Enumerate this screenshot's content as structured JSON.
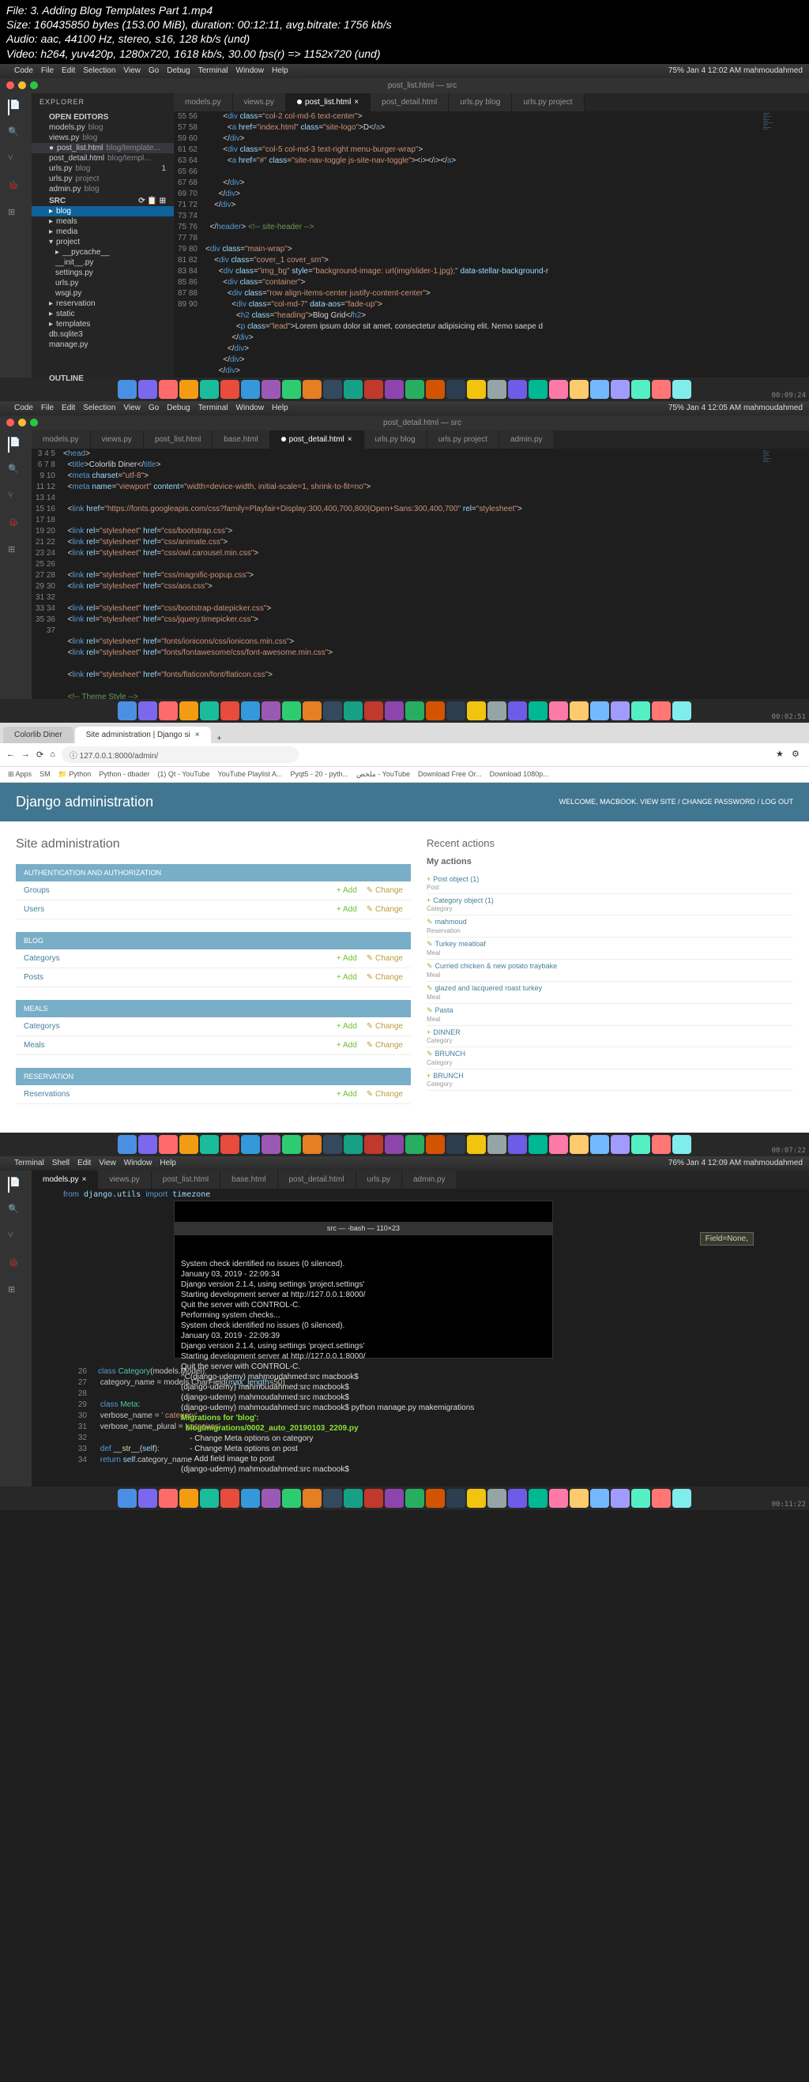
{
  "file_info": {
    "file": "File: 3. Adding Blog Templates Part 1.mp4",
    "size": "Size: 160435850 bytes (153.00 MiB), duration: 00:12:11, avg.bitrate: 1756 kb/s",
    "audio": "Audio: aac, 44100 Hz, stereo, s16, 128 kb/s (und)",
    "video": "Video: h264, yuv420p, 1280x720, 1618 kb/s, 30.00 fps(r) => 1152x720 (und)"
  },
  "menubar1": {
    "app": "Code",
    "items": [
      "File",
      "Edit",
      "Selection",
      "View",
      "Go",
      "Debug",
      "Terminal",
      "Window",
      "Help"
    ],
    "right": "75%  Jan 4 12:02 AM  mahmoudahmed"
  },
  "vscode1": {
    "title": "post_list.html — src",
    "explorer": "EXPLORER",
    "open_editors": "OPEN EDITORS",
    "editors": [
      {
        "name": "models.py",
        "path": "blog"
      },
      {
        "name": "views.py",
        "path": "blog"
      },
      {
        "name": "post_list.html",
        "path": "blog/template..."
      },
      {
        "name": "post_detail.html",
        "path": "blog/templ..."
      },
      {
        "name": "urls.py",
        "path": "blog",
        "badge": "1"
      },
      {
        "name": "urls.py",
        "path": "project"
      },
      {
        "name": "admin.py",
        "path": "blog"
      }
    ],
    "src": "SRC",
    "tree": [
      {
        "name": "blog",
        "type": "folder",
        "selected": true
      },
      {
        "name": "meals",
        "type": "folder"
      },
      {
        "name": "media",
        "type": "folder"
      },
      {
        "name": "project",
        "type": "folder",
        "open": true
      },
      {
        "name": "__pycache__",
        "type": "folder",
        "indent": 1
      },
      {
        "name": "__init__.py",
        "type": "file",
        "indent": 1
      },
      {
        "name": "settings.py",
        "type": "file",
        "indent": 1
      },
      {
        "name": "urls.py",
        "type": "file",
        "indent": 1
      },
      {
        "name": "wsgi.py",
        "type": "file",
        "indent": 1
      },
      {
        "name": "reservation",
        "type": "folder"
      },
      {
        "name": "static",
        "type": "folder"
      },
      {
        "name": "templates",
        "type": "folder"
      },
      {
        "name": "db.sqlite3",
        "type": "file"
      },
      {
        "name": "manage.py",
        "type": "file"
      }
    ],
    "outline": "OUTLINE",
    "tabs": [
      "models.py",
      "views.py",
      "post_list.html",
      "post_detail.html",
      "urls.py blog",
      "urls.py project"
    ],
    "active_tab": 2,
    "line_start": 55,
    "ts": "00:09:24"
  },
  "menubar2": {
    "app": "Code",
    "right": "75%  Jan 4 12:05 AM  mahmoudahmed"
  },
  "vscode2": {
    "title": "post_detail.html — src",
    "tabs": [
      "models.py",
      "views.py",
      "post_list.html",
      "base.html",
      "post_detail.html",
      "urls.py blog",
      "urls.py project",
      "admin.py"
    ],
    "active_tab": 4,
    "line_start": 3,
    "ts": "00:02:51"
  },
  "browser": {
    "tabs": [
      "Colorlib Diner",
      "Site administration | Django si"
    ],
    "url": "127.0.0.1:8000/admin/",
    "bookmarks": [
      "Apps",
      "SM",
      "Python",
      "Python - dbader",
      "(1) Qt - YouTube",
      "YouTube Playlist A...",
      "Pyqt5 - 20 - pyth...",
      "ملخص - YouTube",
      "Download Free Or...",
      "Download 1080p..."
    ],
    "header": "Django administration",
    "welcome": "WELCOME, MACBOOK. VIEW SITE / CHANGE PASSWORD / LOG OUT",
    "site_h": "Site administration",
    "modules": [
      {
        "name": "AUTHENTICATION AND AUTHORIZATION",
        "rows": [
          "Groups",
          "Users"
        ]
      },
      {
        "name": "BLOG",
        "rows": [
          "Categorys",
          "Posts"
        ]
      },
      {
        "name": "MEALS",
        "rows": [
          "Categorys",
          "Meals"
        ]
      },
      {
        "name": "RESERVATION",
        "rows": [
          "Reservations"
        ]
      }
    ],
    "add": "Add",
    "change": "Change",
    "recent": "Recent actions",
    "my_actions": "My actions",
    "actions": [
      {
        "t": "Post object (1)",
        "s": "Post",
        "i": "+"
      },
      {
        "t": "Category object (1)",
        "s": "Category",
        "i": "+"
      },
      {
        "t": "mahmoud",
        "s": "Reservation",
        "i": "e"
      },
      {
        "t": "Turkey meatloaf",
        "s": "Meal",
        "i": "e"
      },
      {
        "t": "Curried chicken & new potato traybake",
        "s": "Meal",
        "i": "e"
      },
      {
        "t": "glazed and lacquered roast turkey",
        "s": "Meal",
        "i": "e"
      },
      {
        "t": "Pasta",
        "s": "Meal",
        "i": "e"
      },
      {
        "t": "DINNER",
        "s": "Category",
        "i": "+"
      },
      {
        "t": "BRUNCH",
        "s": "Category",
        "i": "e"
      },
      {
        "t": "BRUNCH",
        "s": "Category",
        "i": "+"
      }
    ],
    "ts": "00:07:22"
  },
  "menubar3": {
    "app": "Terminal",
    "items": [
      "Shell",
      "Edit",
      "View",
      "Window",
      "Help"
    ],
    "right": "76%  Jan 4 12:09 AM  mahmoudahmed"
  },
  "vscode3": {
    "tabs": [
      "models.py",
      "views.py",
      "post_list.html",
      "base.html",
      "post_detail.html",
      "urls.py",
      "admin.py"
    ],
    "active_tab": 0,
    "import_line": "from django.utils import timezone",
    "field_hint": "Field=None,",
    "ts": "00:11:22"
  },
  "terminal": {
    "title": "src — -bash — 110×23",
    "lines": [
      "System check identified no issues (0 silenced).",
      "January 03, 2019 - 22:09:34",
      "Django version 2.1.4, using settings 'project.settings'",
      "Starting development server at http://127.0.0.1:8000/",
      "Quit the server with CONTROL-C.",
      "Performing system checks...",
      "",
      "System check identified no issues (0 silenced).",
      "January 03, 2019 - 22:09:39",
      "Django version 2.1.4, using settings 'project.settings'",
      "Starting development server at http://127.0.0.1:8000/",
      "Quit the server with CONTROL-C.",
      "^C(django-udemy) mahmoudahmed:src macbook$",
      "(django-udemy) mahmoudahmed:src macbook$",
      "(django-udemy) mahmoudahmed:src macbook$",
      "(django-udemy) mahmoudahmed:src macbook$ python manage.py makemigrations",
      "Migrations for 'blog':",
      "  blog/migrations/0002_auto_20190103_2209.py",
      "    - Change Meta options on category",
      "    - Change Meta options on post",
      "    - Add field image to post",
      "(django-udemy) mahmoudahmed:src macbook$ "
    ]
  },
  "code_below": {
    "start": 26,
    "lines": [
      "class Category(models.Model):",
      "    category_name = models.CharField(max_length=50)",
      "",
      "    class Meta:",
      "        verbose_name = ' category'",
      "        verbose_name_plural = 'catogires'",
      "",
      "    def __str__(self):",
      "        return self.category_name"
    ]
  }
}
